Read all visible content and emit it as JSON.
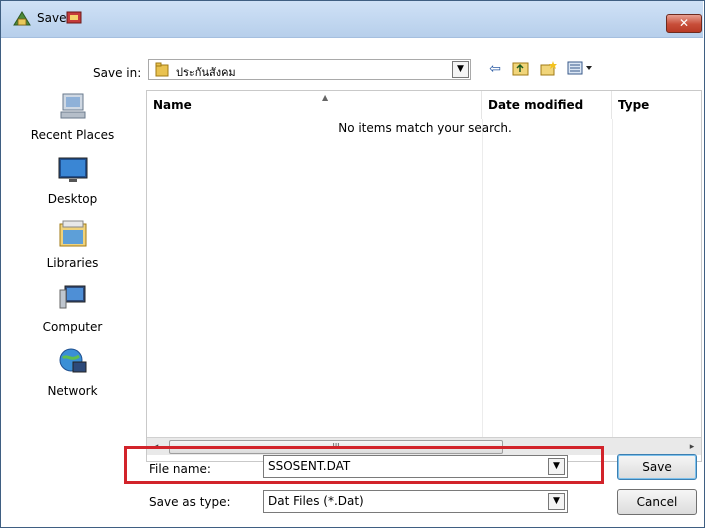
{
  "window": {
    "title": "Save",
    "close_label": "✕"
  },
  "toolbar": {
    "save_in_label": "Save in:",
    "current_folder": "ประกันสังคม",
    "back_icon": "back-arrow-icon",
    "up_icon": "up-folder-icon",
    "new_folder_icon": "new-folder-icon",
    "views_icon": "views-menu-icon"
  },
  "places": [
    {
      "label": "Recent Places",
      "icon": "recent-places-icon"
    },
    {
      "label": "Desktop",
      "icon": "desktop-icon"
    },
    {
      "label": "Libraries",
      "icon": "libraries-icon"
    },
    {
      "label": "Computer",
      "icon": "computer-icon"
    },
    {
      "label": "Network",
      "icon": "network-icon"
    }
  ],
  "file_list": {
    "columns": [
      "Name",
      "Date modified",
      "Type"
    ],
    "empty_message": "No items match your search."
  },
  "scrollbar": {
    "grip": "III",
    "left": "◂",
    "right": "▸"
  },
  "form": {
    "file_name_label": "File name:",
    "file_name_value": "SSOSENT.DAT",
    "save_as_type_label": "Save as type:",
    "save_as_type_value": "Dat Files (*.Dat)"
  },
  "buttons": {
    "save": "Save",
    "cancel": "Cancel"
  },
  "colors": {
    "highlight_box": "#d2232a",
    "title_bar": "#b7cfeb"
  }
}
